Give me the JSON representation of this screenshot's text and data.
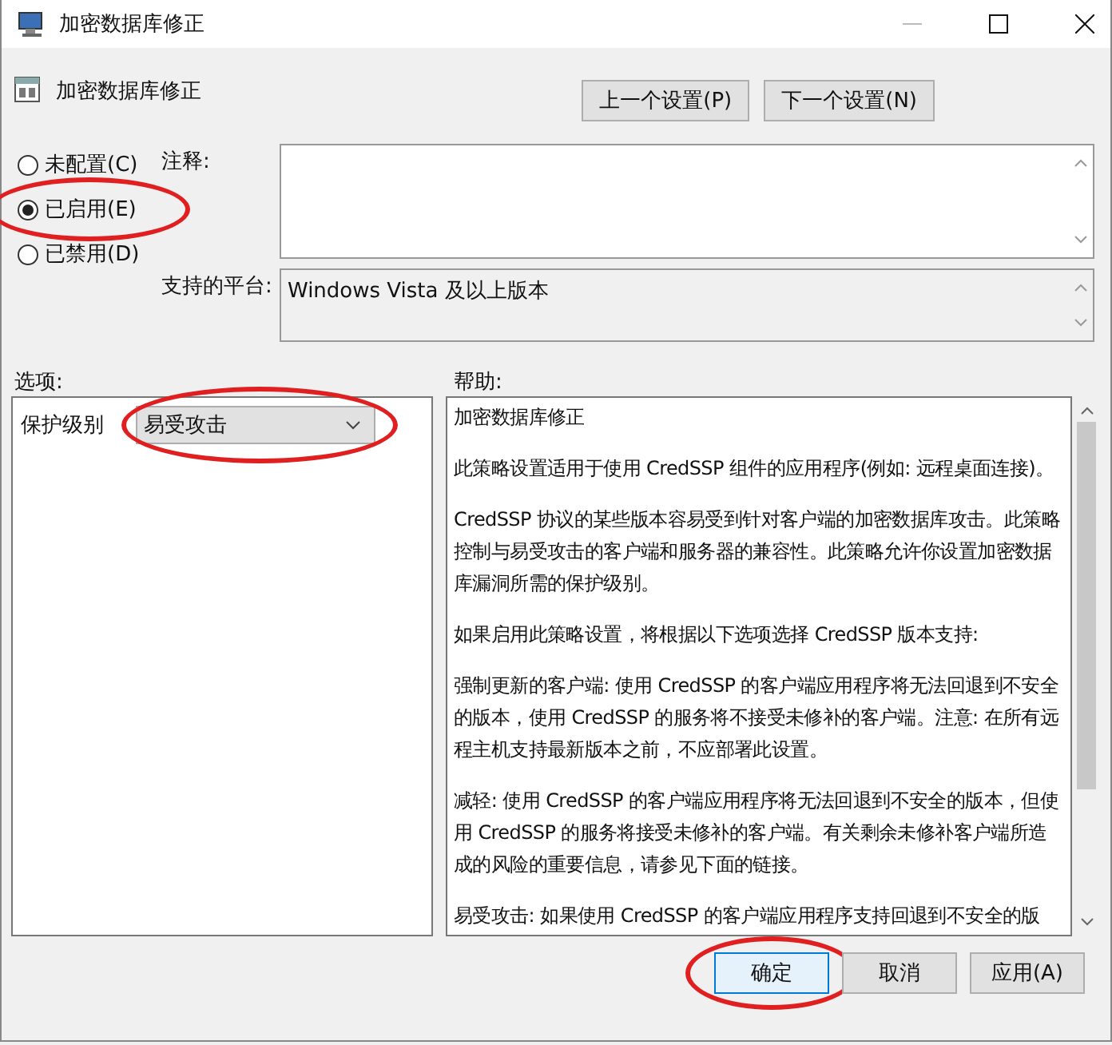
{
  "window": {
    "title": "加密数据库修正"
  },
  "policy": {
    "name": "加密数据库修正"
  },
  "nav_buttons": [
    {
      "label": "上一个设置(P)"
    },
    {
      "label": "下一个设置(N)"
    }
  ],
  "state_options": [
    {
      "label": "未配置(C)",
      "selected": false,
      "highlight": false
    },
    {
      "label": "已启用(E)",
      "selected": true,
      "highlight": true
    },
    {
      "label": "已禁用(D)",
      "selected": false,
      "highlight": false
    }
  ],
  "comment": {
    "label": "注释:"
  },
  "platform": {
    "label": "支持的平台:",
    "value": "Windows Vista 及以上版本"
  },
  "options": {
    "heading": "选项:",
    "fields": [
      {
        "label": "保护级别",
        "value": "易受攻击",
        "highlight": true
      }
    ]
  },
  "help": {
    "heading": "帮助:",
    "paragraphs": [
      "加密数据库修正",
      "此策略设置适用于使用 CredSSP 组件的应用程序(例如: 远程桌面连接)。",
      "CredSSP 协议的某些版本容易受到针对客户端的加密数据库攻击。此策略控制与易受攻击的客户端和服务器的兼容性。此策略允许你设置加密数据库漏洞所需的保护级别。",
      "如果启用此策略设置，将根据以下选项选择 CredSSP 版本支持:",
      "强制更新的客户端: 使用 CredSSP 的客户端应用程序将无法回退到不安全的版本，使用 CredSSP 的服务将不接受未修补的客户端。注意: 在所有远程主机支持最新版本之前，不应部署此设置。",
      "减轻: 使用 CredSSP 的客户端应用程序将无法回退到不安全的版本，但使用 CredSSP 的服务将接受未修补的客户端。有关剩余未修补客户端所造成的风险的重要信息，请参见下面的链接。",
      "易受攻击: 如果使用 CredSSP 的客户端应用程序支持回退到不安全的版"
    ]
  },
  "footer_buttons": [
    {
      "label": "确定",
      "kind": "default",
      "highlight": true
    },
    {
      "label": "取消",
      "kind": "normal",
      "highlight": false
    },
    {
      "label": "应用(A)",
      "kind": "normal",
      "highlight": false
    }
  ]
}
